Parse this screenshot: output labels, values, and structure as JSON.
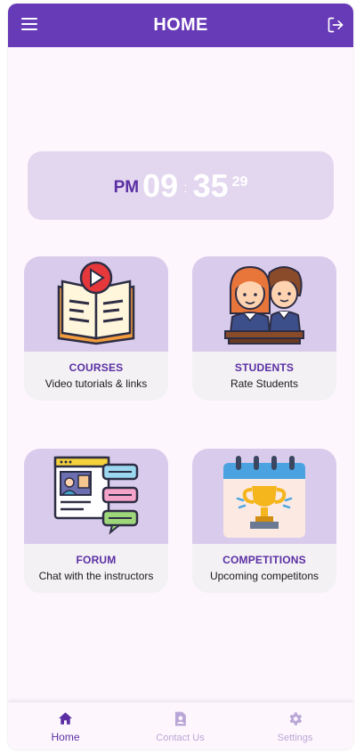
{
  "appbar": {
    "title": "HOME"
  },
  "clock": {
    "ampm": "PM",
    "hour": "09",
    "separator": ":",
    "minute": "35",
    "second": "29"
  },
  "cards": [
    {
      "title": "COURSES",
      "subtitle": "Video tutorials & links",
      "icon": "book-play-icon"
    },
    {
      "title": "STUDENTS",
      "subtitle": "Rate Students",
      "icon": "students-icon"
    },
    {
      "title": "FORUM",
      "subtitle": "Chat with the instructors",
      "icon": "chat-forum-icon"
    },
    {
      "title": "COMPETITIONS",
      "subtitle": "Upcoming competitons",
      "icon": "trophy-calendar-icon"
    }
  ],
  "bottom_nav": [
    {
      "label": "Home",
      "icon": "home-icon",
      "active": true
    },
    {
      "label": "Contact Us",
      "icon": "contact-icon",
      "active": false
    },
    {
      "label": "Settings",
      "icon": "gear-icon",
      "active": false
    }
  ],
  "colors": {
    "primary": "#673ab7",
    "accent_text": "#5b2fa3",
    "card_image_bg": "#d9cbec",
    "clock_bg": "#e2d7ef",
    "inactive_nav": "#b9a6d6"
  }
}
